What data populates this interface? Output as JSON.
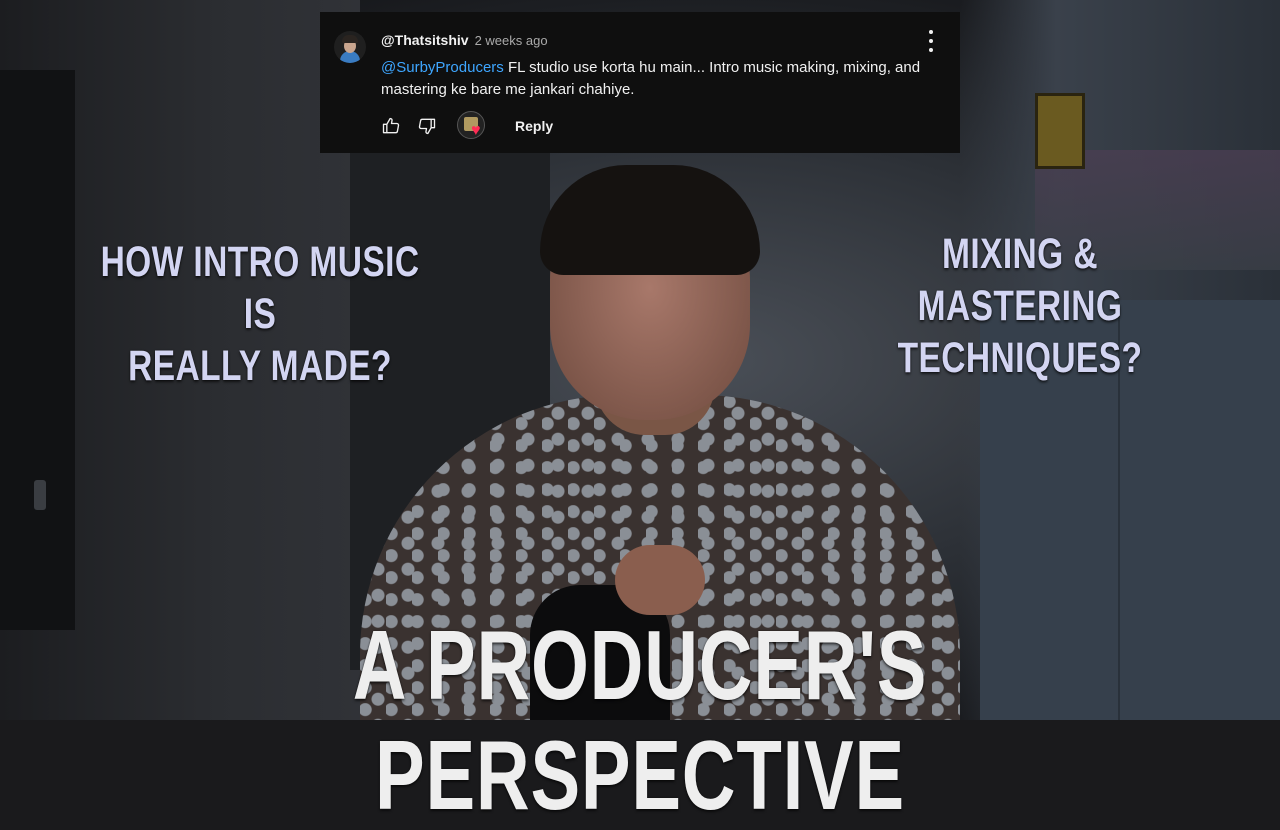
{
  "comment": {
    "username": "@Thatsitshiv",
    "time": "2 weeks ago",
    "mention": "@SurbyProducers",
    "text": " FL studio use korta hu main... Intro music making, mixing, and mastering ke bare me jankari chahiye.",
    "reply_label": "Reply",
    "icons": {
      "avatar": "user-avatar",
      "like": "thumbs-up-icon",
      "dislike": "thumbs-down-icon",
      "creator_heart": "heart-icon",
      "more": "more-vert-icon"
    },
    "colors": {
      "background": "#0f0f0f",
      "mention": "#3ea6ff",
      "heart": "#ff2d55"
    }
  },
  "captions": {
    "left_line1": "HOW INTRO MUSIC IS",
    "left_line2": "REALLY MADE?",
    "right_line1": "MIXING & MASTERING",
    "right_line2": "TECHNIQUES?",
    "bottom": "A PRODUCER'S PERSPECTIVE"
  },
  "colors": {
    "caption_side": "#d3d5f2",
    "caption_bottom": "#eeeeee"
  }
}
